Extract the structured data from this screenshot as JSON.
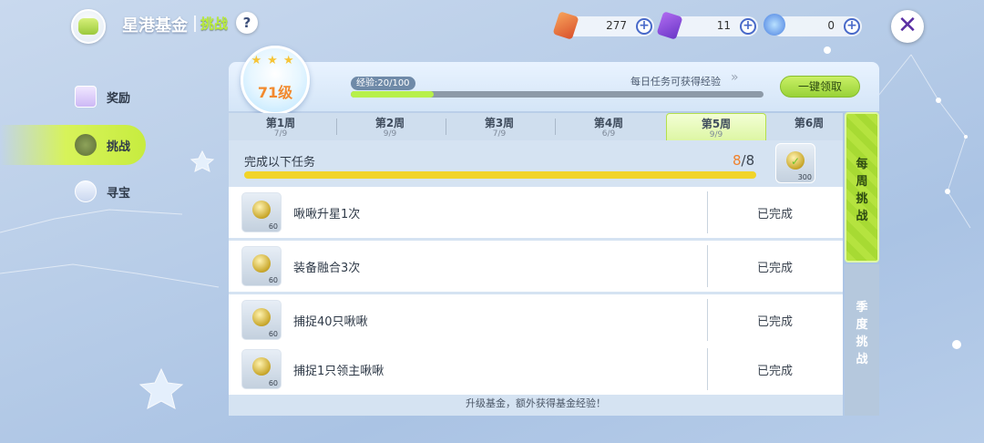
{
  "header": {
    "app_title": "星港基金",
    "title_tag": "挑战",
    "help_symbol": "?",
    "close_symbol": "✕"
  },
  "currencies": [
    {
      "icon": "ticket-icon",
      "amount": "277",
      "plus": "+"
    },
    {
      "icon": "purple-card-icon",
      "amount": "11",
      "plus": "+"
    },
    {
      "icon": "crystal-icon",
      "amount": "0",
      "plus": "+"
    }
  ],
  "nav": {
    "items": [
      {
        "label": "奖励",
        "icon": "gift-icon"
      },
      {
        "label": "挑战",
        "icon": "trophy-icon",
        "active": true
      },
      {
        "label": "寻宝",
        "icon": "treasure-icon"
      }
    ]
  },
  "fund": {
    "level_text": "71级",
    "stars": "★★★",
    "exp_label": "经验:20/100",
    "exp_progress": 0.2,
    "daily_hint": "每日任务可获得经验",
    "daily_arrow": "»",
    "claim_all_label": "一键领取"
  },
  "tabs": [
    {
      "name": "第1周",
      "progress": "7/9"
    },
    {
      "name": "第2周",
      "progress": "9/9"
    },
    {
      "name": "第3周",
      "progress": "7/9"
    },
    {
      "name": "第4周",
      "progress": "6/9"
    },
    {
      "name": "第5周",
      "progress": "9/9",
      "active": true
    },
    {
      "name": "第6周",
      "progress": ""
    }
  ],
  "summary": {
    "title": "完成以下任务",
    "done": "8",
    "total": "/8",
    "reward_qty": "300"
  },
  "tasks": [
    {
      "desc": "啾啾升星1次",
      "reward_qty": "60",
      "status": "已完成"
    },
    {
      "desc": "装备融合3次",
      "reward_qty": "60",
      "status": "已完成"
    },
    {
      "desc": "捕捉40只啾啾",
      "reward_qty": "60",
      "status": "已完成"
    },
    {
      "desc": "捕捉1只领主啾啾",
      "reward_qty": "60",
      "status": "已完成"
    }
  ],
  "footer_note": "升级基金，额外获得基金经验！",
  "side_tabs": {
    "weekly": "每周挑战",
    "season": "季度挑战"
  },
  "colors": {
    "accent_green": "#b5e33f",
    "progress_yellow": "#f1d429",
    "done_orange": "#f0812c"
  }
}
